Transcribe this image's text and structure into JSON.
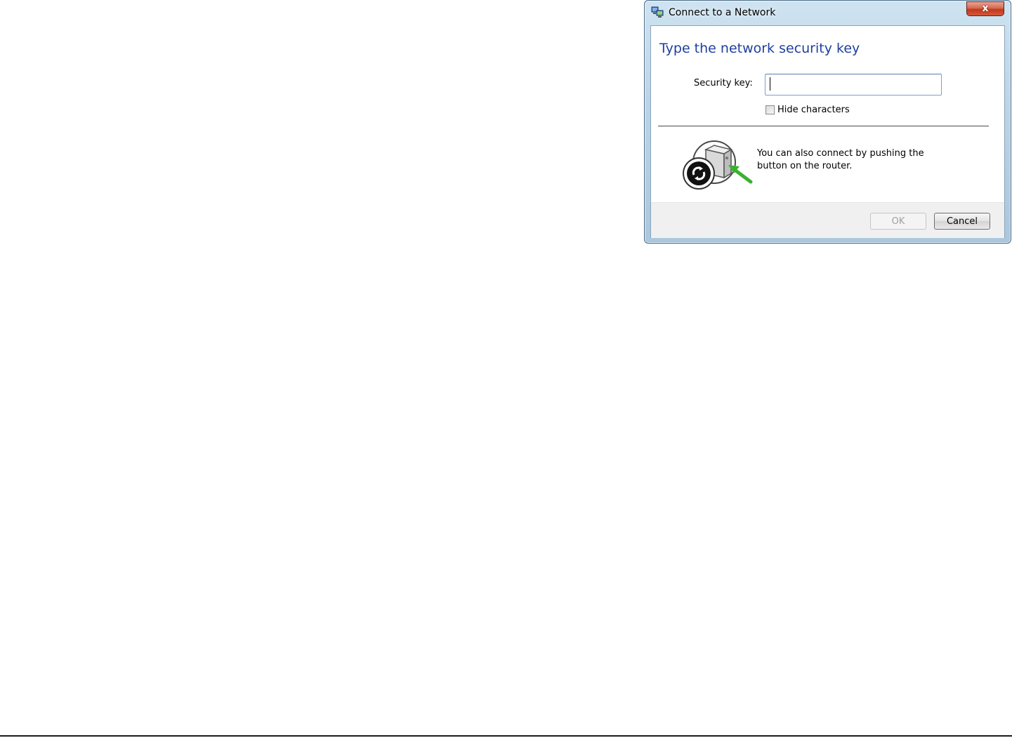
{
  "window": {
    "title": "Connect to a Network",
    "title_icon": "network-icon",
    "close_label": "x"
  },
  "main": {
    "heading": "Type the network security key",
    "security_key_label": "Security key:",
    "security_key_value": "",
    "hide_characters_label": "Hide characters",
    "hide_characters_checked": false,
    "wps_icon": "wps-router-button-icon",
    "wps_text": "You can also connect by pushing the button on the router."
  },
  "buttons": {
    "ok_label": "OK",
    "ok_enabled": false,
    "cancel_label": "Cancel"
  },
  "colors": {
    "heading": "#1f3f9e",
    "close_button": "#c0391f",
    "wps_arrow": "#3cb031"
  }
}
